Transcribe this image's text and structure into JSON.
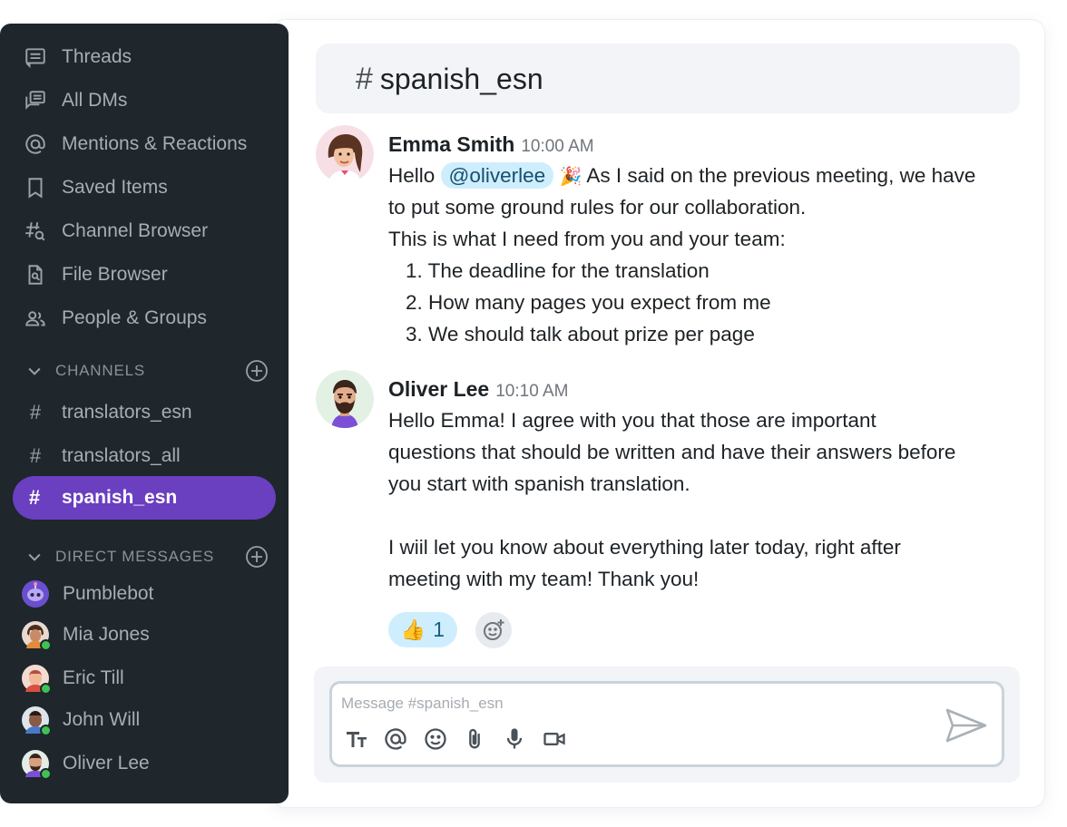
{
  "sidebar": {
    "nav": [
      {
        "label": "Threads",
        "icon": "threads-icon"
      },
      {
        "label": "All DMs",
        "icon": "all-dms-icon"
      },
      {
        "label": "Mentions & Reactions",
        "icon": "at-icon"
      },
      {
        "label": "Saved Items",
        "icon": "bookmark-icon"
      },
      {
        "label": "Channel Browser",
        "icon": "channel-search-icon"
      },
      {
        "label": "File Browser",
        "icon": "file-search-icon"
      },
      {
        "label": "People & Groups",
        "icon": "people-icon"
      }
    ],
    "channels_header": "CHANNELS",
    "channels": [
      {
        "name": "translators_esn",
        "active": false
      },
      {
        "name": "translators_all",
        "active": false
      },
      {
        "name": "spanish_esn",
        "active": true
      }
    ],
    "dm_header": "DIRECT MESSAGES",
    "dms": [
      {
        "name": "Pumblebot",
        "online": false
      },
      {
        "name": "Mia Jones",
        "online": true
      },
      {
        "name": "Eric Till",
        "online": true
      },
      {
        "name": "John Will",
        "online": true
      },
      {
        "name": "Oliver Lee",
        "online": true
      }
    ]
  },
  "channel": {
    "hash": "#",
    "name": "spanish_esn"
  },
  "messages": [
    {
      "author": "Emma Smith",
      "time": "10:00 AM",
      "line1_prefix": "Hello",
      "mention": "@oliverlee",
      "line1_emoji": "🎉",
      "line1_suffix": "As I said on the previous meeting, we have",
      "line2": "to put some ground rules for our collaboration.",
      "line3": "This is what I need from you and your team:",
      "list": [
        "1. The deadline for the translation",
        "2. How many pages you expect from me",
        "3. We should talk about prize per page"
      ]
    },
    {
      "author": "Oliver Lee",
      "time": "10:10 AM",
      "lines": [
        "Hello Emma! I agree with you that those are important",
        "questions that should be written and have their answers before",
        "you start with spanish translation.",
        "I wiil let you know about everything later today, right after",
        "meeting with my team! Thank you!"
      ],
      "reaction": {
        "emoji": "👍",
        "count": "1"
      }
    }
  ],
  "composer": {
    "placeholder": "Message #spanish_esn",
    "tools": [
      "text-format-icon",
      "mention-icon",
      "emoji-icon",
      "attach-icon",
      "mic-icon",
      "video-icon"
    ]
  },
  "colors": {
    "sidebar_bg": "#1f262c",
    "active_channel": "#6a3fc0",
    "mention_bg": "#cfeefd",
    "online": "#3fc251"
  }
}
